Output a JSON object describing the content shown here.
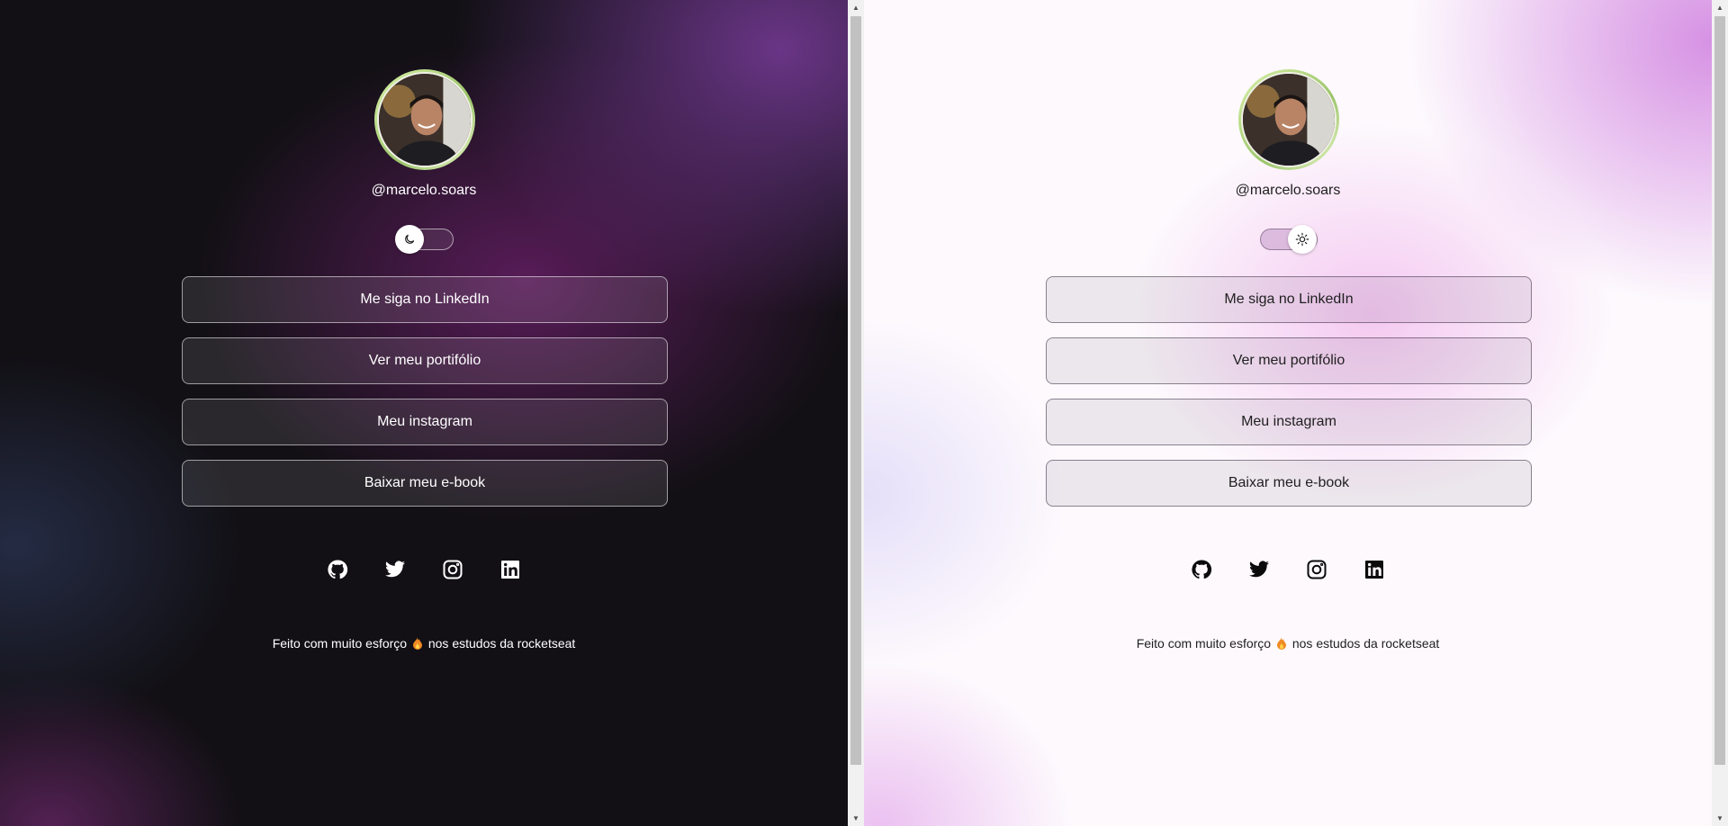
{
  "profile": {
    "username": "@marcelo.soars",
    "avatar_alt": "Foto de Marcelo Soares"
  },
  "theme_switch": {
    "dark_icon": "moon-icon",
    "light_icon": "sun-icon"
  },
  "links": [
    {
      "label": "Me siga no LinkedIn"
    },
    {
      "label": "Ver meu portifólio"
    },
    {
      "label": "Meu instagram"
    },
    {
      "label": "Baixar meu e-book"
    }
  ],
  "socials": [
    {
      "name": "github-icon"
    },
    {
      "name": "twitter-icon"
    },
    {
      "name": "instagram-icon"
    },
    {
      "name": "linkedin-icon"
    }
  ],
  "footer": {
    "before": "Feito com muito esforço",
    "after": "nos estudos da rocketseat",
    "emoji_icon": "fire-icon"
  },
  "colors": {
    "dark_accent": "#5e2a6e",
    "light_accent": "#d48ce2",
    "avatar_ring": "#9bc46a"
  }
}
